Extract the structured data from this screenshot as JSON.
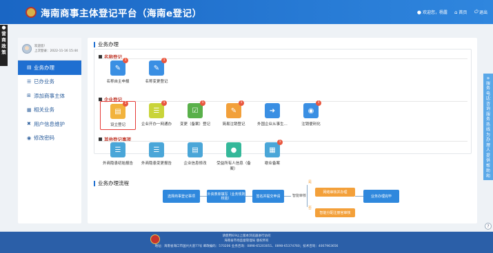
{
  "header": {
    "title": "海南商事主体登记平台（海南e登记）",
    "welcome": "欢迎您，杨露",
    "home": "首页",
    "logout": "退出"
  },
  "left_strip": "营商政策",
  "sidebar": {
    "user_name": "欢迎您!",
    "last_login": "上次登录：2022-11-16 15:44",
    "items": [
      {
        "label": "业务办理",
        "icon": "document-icon",
        "active": true
      },
      {
        "label": "已办业务",
        "icon": "list-icon"
      },
      {
        "label": "添加商事主体",
        "icon": "add-icon"
      },
      {
        "label": "相关业务",
        "icon": "related-icon"
      },
      {
        "label": "用户信息维护",
        "icon": "wrench-icon"
      },
      {
        "label": "修改密码",
        "icon": "lock-icon"
      }
    ]
  },
  "main": {
    "section_title": "业务办理",
    "categories": [
      {
        "title": "名称登记",
        "tiles": [
          {
            "label": "名称自主申报",
            "badge": "1",
            "color": "#3a8fe3"
          },
          {
            "label": "名称变更登记",
            "badge": "1",
            "color": "#3a8fe3"
          }
        ]
      },
      {
        "title": "企业登记",
        "tiles": [
          {
            "label": "设立登记",
            "badge": "1",
            "color": "#f2b33d",
            "selected": true
          },
          {
            "label": "企业开办一网通办",
            "badge": "1",
            "color": "#c9d43a"
          },
          {
            "label": "变更（备案）登记",
            "badge": "1",
            "color": "#59b04a"
          },
          {
            "label": "简易注销登记",
            "badge": "1",
            "color": "#f2a03a"
          },
          {
            "label": "外国企业从事生...",
            "badge": "",
            "color": "#3a8fe3"
          },
          {
            "label": "注销便利化",
            "badge": "1",
            "color": "#3a8fe3"
          }
        ]
      },
      {
        "title": "其他登记事项",
        "tiles": [
          {
            "label": "外商隐患初始报告",
            "badge": "",
            "color": "#4aa6d8"
          },
          {
            "label": "外商隐患变更报告",
            "badge": "",
            "color": "#4aa6d8"
          },
          {
            "label": "企业信息修改",
            "badge": "",
            "color": "#4aa6d8"
          },
          {
            "label": "受益所有人信息（备案）",
            "badge": "",
            "color": "#35b89a"
          },
          {
            "label": "歇业备案",
            "badge": "1",
            "color": "#4aa6d8"
          }
        ]
      }
    ],
    "flow_title": "业务办理流程",
    "flow": {
      "step1": "选择商事登记事项",
      "step2": "外资表单填写（业务规则校验）",
      "step3": "签名并提交申请",
      "step4": "智能审核",
      "step5": "网络审核并办理",
      "step6": "智能分配注册官审核",
      "step7": "业务办理完毕",
      "yes": "是",
      "no": "否"
    }
  },
  "right_panel": "服务电话：咨询服务热线为办理人提供帮助和指导",
  "footer": {
    "line1": "请使用IE9以上版本浏览器进行访问",
    "line2": "海南省市场监督管理局 版权所有",
    "line3": "地址：海南省海口市国兴大道77号 邮政编码：570206 业务咨询：0898-65203051、0898-65374760；技术咨询：4007963656"
  },
  "help": "?"
}
